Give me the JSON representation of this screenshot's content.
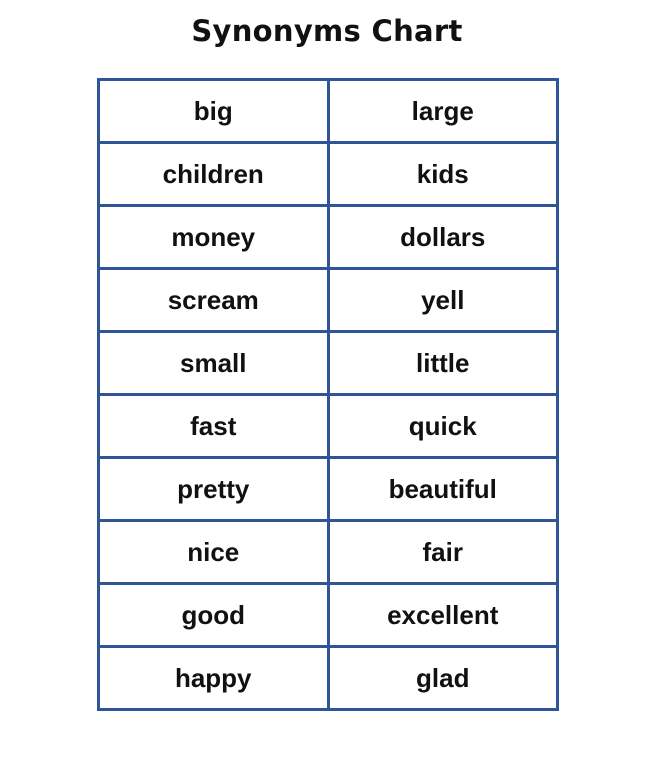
{
  "title": "Synonyms Chart",
  "accent_color": "#2f5597",
  "rows": [
    {
      "word": "big",
      "synonym": "large"
    },
    {
      "word": "children",
      "synonym": "kids"
    },
    {
      "word": "money",
      "synonym": "dollars"
    },
    {
      "word": "scream",
      "synonym": "yell"
    },
    {
      "word": "small",
      "synonym": "little"
    },
    {
      "word": "fast",
      "synonym": "quick"
    },
    {
      "word": "pretty",
      "synonym": "beautiful"
    },
    {
      "word": "nice",
      "synonym": "fair"
    },
    {
      "word": "good",
      "synonym": "excellent"
    },
    {
      "word": "happy",
      "synonym": "glad"
    }
  ]
}
